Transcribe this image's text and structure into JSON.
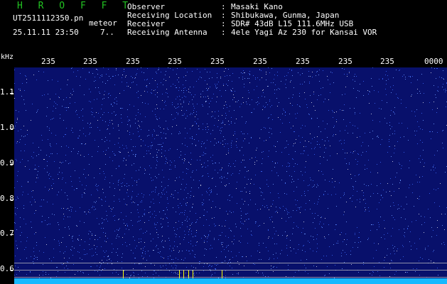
{
  "header": {
    "app_title": "H R O F F T",
    "file_name": "UT2511112350.pn",
    "tag": "meteor",
    "timestamp": "25.11.11 23:50",
    "count": "7..",
    "info": [
      {
        "label": "Observer",
        "value": "Masaki Kano"
      },
      {
        "label": "Receiving Location",
        "value": "Shibukawa, Gunma, Japan"
      },
      {
        "label": "Receiver",
        "value": "SDR# 43dB L15 111.6MHz USB"
      },
      {
        "label": "Receiving Antenna",
        "value": "4ele Yagi Az 230 for Kansai VOR"
      }
    ],
    "separator": ":"
  },
  "spectrogram": {
    "y_unit": "kHz",
    "y_labels": [
      "1.1",
      "1.0",
      "0.9",
      "0.8",
      "0.7",
      "0.6"
    ],
    "time_labels": [
      "235",
      "235",
      "235",
      "235",
      "235",
      "235",
      "235",
      "235",
      "235",
      "0000"
    ],
    "colors": {
      "background": "#08106b",
      "noise": "#3d6bff",
      "baseline": "#16b9ff",
      "marker": "#ffff00"
    }
  }
}
